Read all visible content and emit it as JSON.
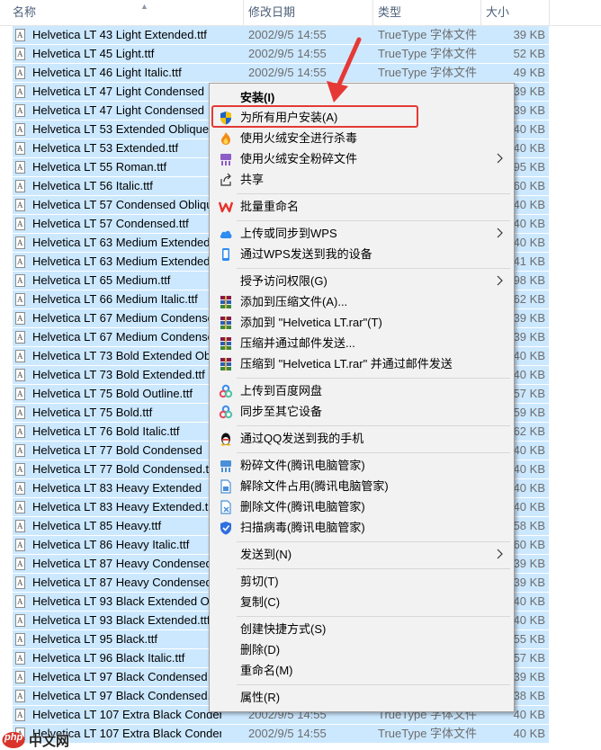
{
  "columns": {
    "name": "名称",
    "date": "修改日期",
    "type": "类型",
    "size": "大小"
  },
  "files": [
    {
      "name": "Helvetica LT 43 Light Extended.ttf",
      "date": "2002/9/5 14:55",
      "type": "TrueType 字体文件",
      "size": "39 KB"
    },
    {
      "name": "Helvetica LT 45 Light.ttf",
      "date": "2002/9/5 14:55",
      "type": "TrueType 字体文件",
      "size": "52 KB"
    },
    {
      "name": "Helvetica LT 46 Light Italic.ttf",
      "date": "2002/9/5 14:55",
      "type": "TrueType 字体文件",
      "size": "49 KB"
    },
    {
      "name": "Helvetica LT 47 Light Condensed",
      "date": "",
      "type": "",
      "size": "39 KB"
    },
    {
      "name": "Helvetica LT 47 Light Condensed",
      "date": "",
      "type": "",
      "size": "39 KB"
    },
    {
      "name": "Helvetica LT 53 Extended Oblique",
      "date": "",
      "type": "",
      "size": "40 KB"
    },
    {
      "name": "Helvetica LT 53 Extended.ttf",
      "date": "",
      "type": "",
      "size": "40 KB"
    },
    {
      "name": "Helvetica LT 55 Roman.ttf",
      "date": "",
      "type": "",
      "size": "95 KB"
    },
    {
      "name": "Helvetica LT 56 Italic.ttf",
      "date": "",
      "type": "",
      "size": "60 KB"
    },
    {
      "name": "Helvetica LT 57 Condensed Obliqu",
      "date": "",
      "type": "",
      "size": "40 KB"
    },
    {
      "name": "Helvetica LT 57 Condensed.ttf",
      "date": "",
      "type": "",
      "size": "40 KB"
    },
    {
      "name": "Helvetica LT 63 Medium Extended",
      "date": "",
      "type": "",
      "size": "40 KB"
    },
    {
      "name": "Helvetica LT 63 Medium Extended",
      "date": "",
      "type": "",
      "size": "41 KB"
    },
    {
      "name": "Helvetica LT 65 Medium.ttf",
      "date": "",
      "type": "",
      "size": "98 KB"
    },
    {
      "name": "Helvetica LT 66 Medium Italic.ttf",
      "date": "",
      "type": "",
      "size": "62 KB"
    },
    {
      "name": "Helvetica LT 67 Medium Condense",
      "date": "",
      "type": "",
      "size": "39 KB"
    },
    {
      "name": "Helvetica LT 67 Medium Condense",
      "date": "",
      "type": "",
      "size": "39 KB"
    },
    {
      "name": "Helvetica LT 73 Bold Extended Ob",
      "date": "",
      "type": "",
      "size": "40 KB"
    },
    {
      "name": "Helvetica LT 73 Bold Extended.ttf",
      "date": "",
      "type": "",
      "size": "40 KB"
    },
    {
      "name": "Helvetica LT 75 Bold Outline.ttf",
      "date": "",
      "type": "",
      "size": "57 KB"
    },
    {
      "name": "Helvetica LT 75 Bold.ttf",
      "date": "",
      "type": "",
      "size": "59 KB"
    },
    {
      "name": "Helvetica LT 76 Bold Italic.ttf",
      "date": "",
      "type": "",
      "size": "62 KB"
    },
    {
      "name": "Helvetica LT 77 Bold Condensed",
      "date": "",
      "type": "",
      "size": "40 KB"
    },
    {
      "name": "Helvetica LT 77 Bold Condensed.t",
      "date": "",
      "type": "",
      "size": "40 KB"
    },
    {
      "name": "Helvetica LT 83 Heavy Extended",
      "date": "",
      "type": "",
      "size": "40 KB"
    },
    {
      "name": "Helvetica LT 83 Heavy Extended.t",
      "date": "",
      "type": "",
      "size": "40 KB"
    },
    {
      "name": "Helvetica LT 85 Heavy.ttf",
      "date": "",
      "type": "",
      "size": "58 KB"
    },
    {
      "name": "Helvetica LT 86 Heavy Italic.ttf",
      "date": "",
      "type": "",
      "size": "60 KB"
    },
    {
      "name": "Helvetica LT 87 Heavy Condensed",
      "date": "",
      "type": "",
      "size": "39 KB"
    },
    {
      "name": "Helvetica LT 87 Heavy Condensed",
      "date": "",
      "type": "",
      "size": "39 KB"
    },
    {
      "name": "Helvetica LT 93 Black Extended O",
      "date": "",
      "type": "",
      "size": "40 KB"
    },
    {
      "name": "Helvetica LT 93 Black Extended.ttf",
      "date": "",
      "type": "",
      "size": "40 KB"
    },
    {
      "name": "Helvetica LT 95 Black.ttf",
      "date": "",
      "type": "",
      "size": "55 KB"
    },
    {
      "name": "Helvetica LT 96 Black Italic.ttf",
      "date": "",
      "type": "",
      "size": "57 KB"
    },
    {
      "name": "Helvetica LT 97 Black Condensed",
      "date": "",
      "type": "",
      "size": "39 KB"
    },
    {
      "name": "Helvetica LT 97 Black Condensed.t",
      "date": "",
      "type": "",
      "size": "38 KB"
    },
    {
      "name": "Helvetica LT 107 Extra Black Condens...",
      "date": "2002/9/5 14:55",
      "type": "TrueType 字体文件",
      "size": "40 KB"
    },
    {
      "name": "Helvetica LT 107 Extra Black Condens...",
      "date": "2002/9/5 14:55",
      "type": "TrueType 字体文件",
      "size": "40 KB"
    }
  ],
  "menu": {
    "install": "安装(I)",
    "install_all": "为所有用户安装(A)",
    "huorong_scan": "使用火绒安全进行杀毒",
    "huorong_shred": "使用火绒安全粉碎文件",
    "share": "共享",
    "batch_rename": "批量重命名",
    "wps_upload": "上传或同步到WPS",
    "wps_send": "通过WPS发送到我的设备",
    "grant_access": "授予访问权限(G)",
    "rar_add": "添加到压缩文件(A)...",
    "rar_add_named": "添加到 \"Helvetica LT.rar\"(T)",
    "rar_email": "压缩并通过邮件发送...",
    "rar_named_email": "压缩到 \"Helvetica LT.rar\" 并通过邮件发送",
    "baidu_upload": "上传到百度网盘",
    "sync_other": "同步至其它设备",
    "qq_send": "通过QQ发送到我的手机",
    "tencent_shred": "粉碎文件(腾讯电脑管家)",
    "tencent_unlock": "解除文件占用(腾讯电脑管家)",
    "tencent_delete": "删除文件(腾讯电脑管家)",
    "tencent_scan": "扫描病毒(腾讯电脑管家)",
    "send_to": "发送到(N)",
    "cut": "剪切(T)",
    "copy": "复制(C)",
    "create_shortcut": "创建快捷方式(S)",
    "delete": "删除(D)",
    "rename": "重命名(M)",
    "properties": "属性(R)"
  },
  "watermark": {
    "brand": "php",
    "text": "中文网"
  },
  "colors": {
    "selection": "#cce8ff",
    "highlight_box": "#e53935",
    "menu_bg": "#f2f2f2"
  }
}
